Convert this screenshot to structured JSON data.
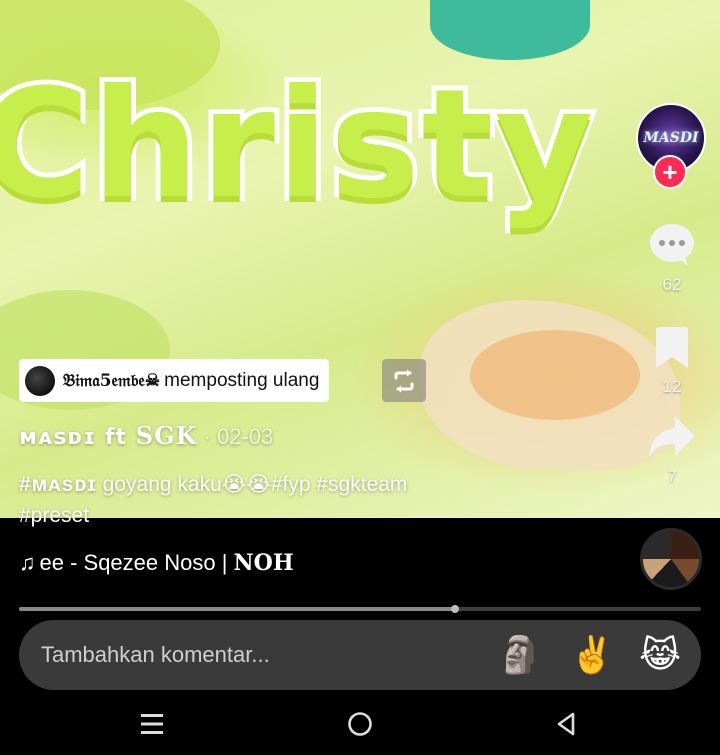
{
  "video": {
    "overlay_word": "Christy"
  },
  "rail": {
    "comment_count": "62",
    "save_count": "12",
    "share_count": "7",
    "follow_symbol": "+",
    "avatar_text": "MASDI"
  },
  "repost": {
    "username": "𝔅𝔦𝔪𝔞5𝔢𝔪𝔟𝔢☠︎",
    "label": "memposting ulang"
  },
  "author": {
    "name": "ᴍᴀsᴅɪ",
    "ft": "ft",
    "collab": "SGK",
    "date": "· 02-03"
  },
  "caption": {
    "tag1": "#ᴍᴀsᴅɪ",
    "text": " goyang kaku😭😭",
    "tag2": "#fyp",
    "tag3": " #sgkteam",
    "tag4": "#preset"
  },
  "music": {
    "note": "♫",
    "title": "ee - Sqezee Noso | ",
    "title_suffix": "NOH"
  },
  "progress": {
    "fraction": 0.64
  },
  "comment": {
    "placeholder": "Tambahkan komentar...",
    "emoji_1": "🗿",
    "emoji_2": "✌️",
    "emoji_3": "😹"
  },
  "colors": {
    "follow": "#fe2c55",
    "comment_bar": "#3a3a3a",
    "video_green": "#c7ee4a"
  }
}
